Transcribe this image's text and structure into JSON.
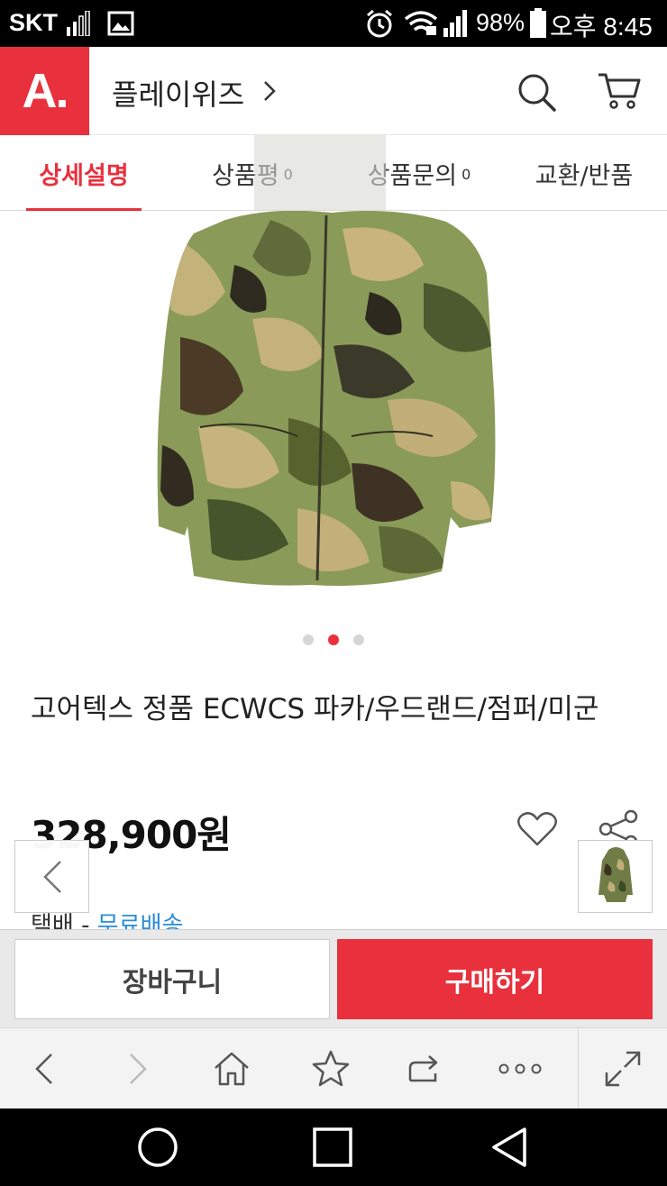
{
  "status_bar": {
    "carrier": "SKT",
    "battery_percent": "98%",
    "time": "오후 8:45",
    "icons": [
      "signal-icon",
      "gallery-icon",
      "alarm-icon",
      "wifi-icon",
      "signal-icon",
      "battery-icon"
    ]
  },
  "header": {
    "logo_text": "A.",
    "shop_name": "플레이위즈",
    "icons": [
      "chevron-right-icon",
      "search-icon",
      "cart-icon"
    ],
    "brand_color": "#e8313d"
  },
  "tabs": [
    {
      "label": "상세설명",
      "count": "",
      "active": true
    },
    {
      "label": "상품평",
      "count": "0",
      "active": false
    },
    {
      "label": "상품문의",
      "count": "0",
      "active": false
    },
    {
      "label": "교환/반품",
      "count": "",
      "active": false
    }
  ],
  "carousel": {
    "total": 3,
    "active_index": 1
  },
  "product": {
    "title": "고어텍스 정품 ECWCS 파카/우드랜드/점퍼/미군",
    "price": "328,900원",
    "shipping_label": "택배",
    "shipping_separator": " - ",
    "shipping_value": "무료배송"
  },
  "actions": {
    "cart_label": "장바구니",
    "buy_label": "구매하기"
  },
  "browser_toolbar": {
    "icons": [
      "back-icon",
      "forward-icon",
      "home-icon",
      "bookmark-star-icon",
      "share-tab-icon",
      "more-icon",
      "fullscreen-icon"
    ]
  },
  "system_nav": {
    "icons": [
      "home-circle-icon",
      "recents-square-icon",
      "back-triangle-icon"
    ]
  }
}
